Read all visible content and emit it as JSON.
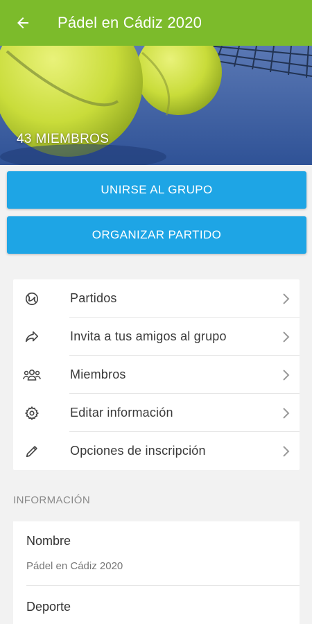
{
  "appbar": {
    "title": "Pádel en Cádiz 2020",
    "color": "#7cbb2b"
  },
  "hero": {
    "members": "43 MIEMBROS"
  },
  "buttons": {
    "join": "UNIRSE AL GRUPO",
    "organize": "ORGANIZAR PARTIDO",
    "color": "#1ea5e5"
  },
  "menu": {
    "items": [
      {
        "label": "Partidos",
        "icon": "tennis-ball-icon"
      },
      {
        "label": "Invita a tus amigos al grupo",
        "icon": "share-icon"
      },
      {
        "label": "Miembros",
        "icon": "members-icon"
      },
      {
        "label": "Editar información",
        "icon": "gear-icon"
      },
      {
        "label": "Opciones de inscripción",
        "icon": "pencil-icon"
      }
    ]
  },
  "info": {
    "section_title": "INFORMACIÓN",
    "name_label": "Nombre",
    "name_value": "Pádel en Cádiz 2020",
    "sport_label": "Deporte"
  }
}
